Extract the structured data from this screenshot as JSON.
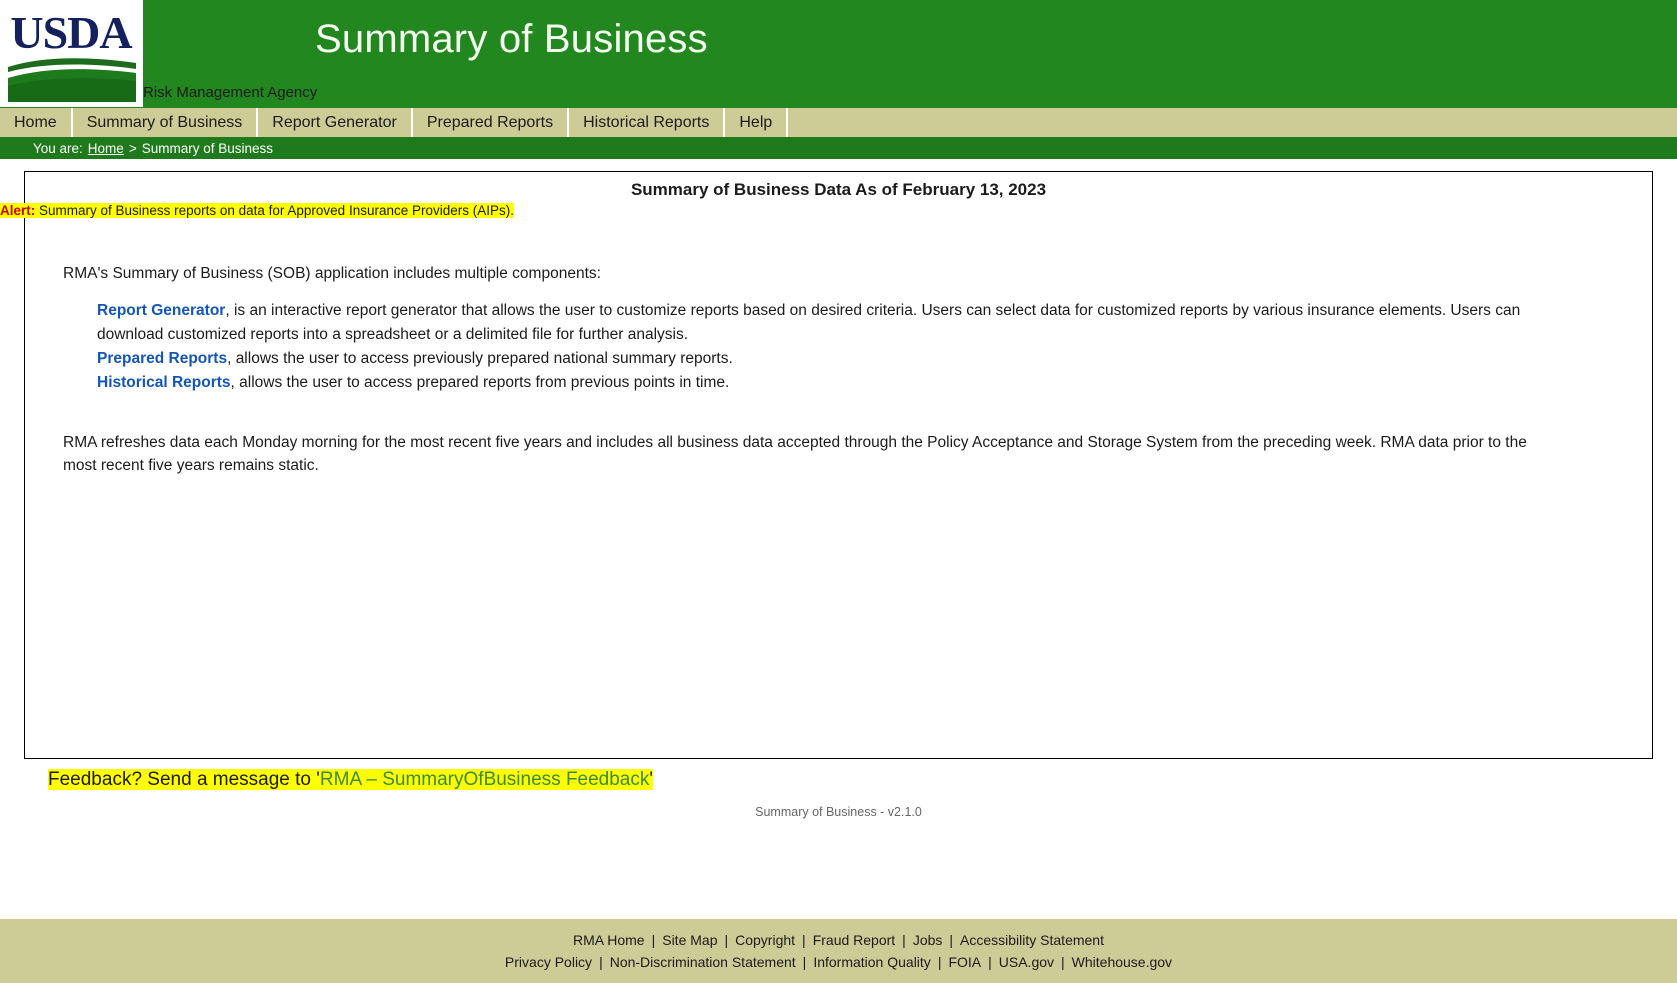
{
  "banner": {
    "title": "Summary of Business",
    "agency": "Risk Management Agency",
    "logo_alt": "usda-logo"
  },
  "nav": {
    "items": [
      {
        "label": "Home"
      },
      {
        "label": "Summary of Business"
      },
      {
        "label": "Report Generator"
      },
      {
        "label": "Prepared Reports"
      },
      {
        "label": "Historical Reports"
      },
      {
        "label": "Help"
      }
    ]
  },
  "breadcrumb": {
    "prefix": "You are:",
    "home": "Home",
    "separator": ">",
    "current": "Summary of Business"
  },
  "main": {
    "data_title": "Summary of Business Data As of February 13, 2023",
    "alert_label": "Alert:",
    "alert_text": "Summary of Business reports on data for Approved Insurance Providers (AIPs).",
    "intro": "RMA's Summary of Business (SOB) application includes multiple components:",
    "components": [
      {
        "link": "Report Generator",
        "text": ", is an interactive report generator that allows the user to customize reports based on desired criteria. Users can select data for customized reports by various insurance elements. Users can download customized reports into a spreadsheet or a delimited file for further analysis."
      },
      {
        "link": "Prepared Reports",
        "text": ", allows the user to access previously prepared national summary reports."
      },
      {
        "link": "Historical Reports",
        "text": ", allows the user to access prepared reports from previous points in time."
      }
    ],
    "refresh_note": "RMA refreshes data each Monday morning for the most recent five years and includes all business data accepted through the Policy Acceptance and Storage System from the preceding week. RMA data prior to the most recent five years remains static."
  },
  "feedback": {
    "prefix": "Feedback? Send a message to '",
    "link": "RMA – SummaryOfBusiness Feedback",
    "suffix": "'"
  },
  "version": "Summary of Business - v2.1.0",
  "footer": {
    "row1": [
      "RMA Home",
      "Site Map",
      "Copyright",
      "Fraud Report",
      "Jobs",
      "Accessibility Statement"
    ],
    "row2": [
      "Privacy Policy",
      "Non-Discrimination Statement",
      "Information Quality",
      "FOIA",
      "USA.gov",
      "Whitehouse.gov"
    ],
    "separator": "|"
  },
  "colors": {
    "banner_green": "#23871f",
    "breadcrumb_green": "#1f7a1c",
    "nav_tan": "#cdcb96",
    "link_blue": "#1355b8",
    "alert_red": "#d00000",
    "highlight_yellow": "#ffff00",
    "feedback_green": "#3c8a3c"
  }
}
